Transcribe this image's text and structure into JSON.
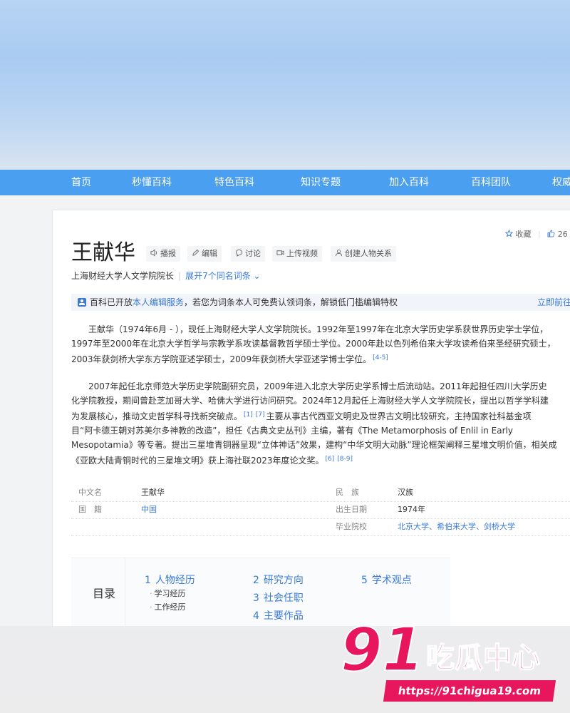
{
  "nav": {
    "items": [
      "首页",
      "秒懂百科",
      "特色百科",
      "知识专题",
      "加入百科",
      "百科团队",
      "权威"
    ]
  },
  "lemma": {
    "title": "王献华",
    "tools": [
      "播报",
      "编辑",
      "讨论",
      "上传视频",
      "创建人物关系"
    ],
    "description": "上海财经大学人文学院院长",
    "polysemy_link": "展开7个同名词条",
    "favorite": "收藏",
    "like_count": "26"
  },
  "notice": {
    "prefix": "百科已开放",
    "link": "本人编辑服务",
    "suffix": "，若您为词条本人可免费认领词条，解锁低门槛编辑特权",
    "action": "立即前往"
  },
  "paragraphs": [
    {
      "lines": [
        {
          "text": "王献华（1974年6月 - ），现任上海财经大学人文学院院长。1992年至1997年在北京大学历史学系获世界历史学士学位，",
          "refs": []
        },
        {
          "text": "1997年至2000年在北京大学哲学与宗教学系攻读基督教哲学硕士学位。2000年赴以色列希伯来大学攻读希伯来圣经研究硕士，",
          "refs": []
        },
        {
          "text": "2003年获剑桥大学东方学院亚述学硕士，2009年获剑桥大学亚述学博士学位。",
          "refs": [
            "[4-5]"
          ]
        }
      ]
    },
    {
      "lines": [
        {
          "text": "2007年起任北京师范大学历史学院副研究员，2009年进入北京大学历史学系博士后流动站。2011年起担任四川大学历史",
          "refs": []
        },
        {
          "text": "化学院教授，期间曾赴芝加哥大学、哈佛大学进行访问研究。2024年12月起任上海财经大学人文学院院长，提出以哲学学科建",
          "refs": []
        },
        {
          "text": "为发展核心，推动文史哲学科寻找新突破点。",
          "refs": [
            "[1]",
            "[7]"
          ],
          "after": "主要从事古代西亚文明史及世界古文明比较研究，主持国家社科基金项"
        },
        {
          "text": "目“阿卡德王朝对苏美尔多神教的改造”，担任《古典文史丛刊》主编，著有《The Metamorphosis of Enlil in Early",
          "refs": []
        },
        {
          "text": "Mesopotamia》等专著。提出三星堆青铜器呈现“立体神话”效果，建构“中华文明大动脉”理论框架阐释三星堆文明价值，相关成",
          "refs": []
        },
        {
          "text": "《亚欧大陆青铜时代的三星堆文明》获上海社联2023年度论文奖。",
          "refs": [
            "[6]",
            "[8-9]"
          ]
        }
      ]
    }
  ],
  "infobox": {
    "rows": [
      {
        "l_label": "中文名",
        "l_value": "王献华",
        "r_label": "民　族",
        "r_value": "汉族"
      },
      {
        "l_label": "国　籍",
        "l_value": "中国",
        "r_label": "出生日期",
        "r_value": "1974年"
      },
      {
        "l_label": "",
        "l_value": "",
        "r_label": "毕业院校",
        "r_value": "北京大学、希伯来大学、剑桥大学"
      }
    ]
  },
  "toc": {
    "title": "目录",
    "items": [
      {
        "num": "1",
        "label": "人物经历",
        "subs": [
          "学习经历",
          "工作经历"
        ]
      },
      {
        "num": "2",
        "label": "研究方向",
        "subs": []
      },
      {
        "num": "3",
        "label": "社会任职",
        "subs": []
      },
      {
        "num": "4",
        "label": "主要作品",
        "subs": []
      },
      {
        "num": "5",
        "label": "学术观点",
        "subs": []
      }
    ]
  },
  "watermark": {
    "number": "91",
    "name": "吃瓜中心",
    "url": "https://91chigua19.com"
  },
  "colors": {
    "nav_bg": "#4a9ff0",
    "link": "#3a7ad6",
    "watermark": "#e8175d"
  }
}
